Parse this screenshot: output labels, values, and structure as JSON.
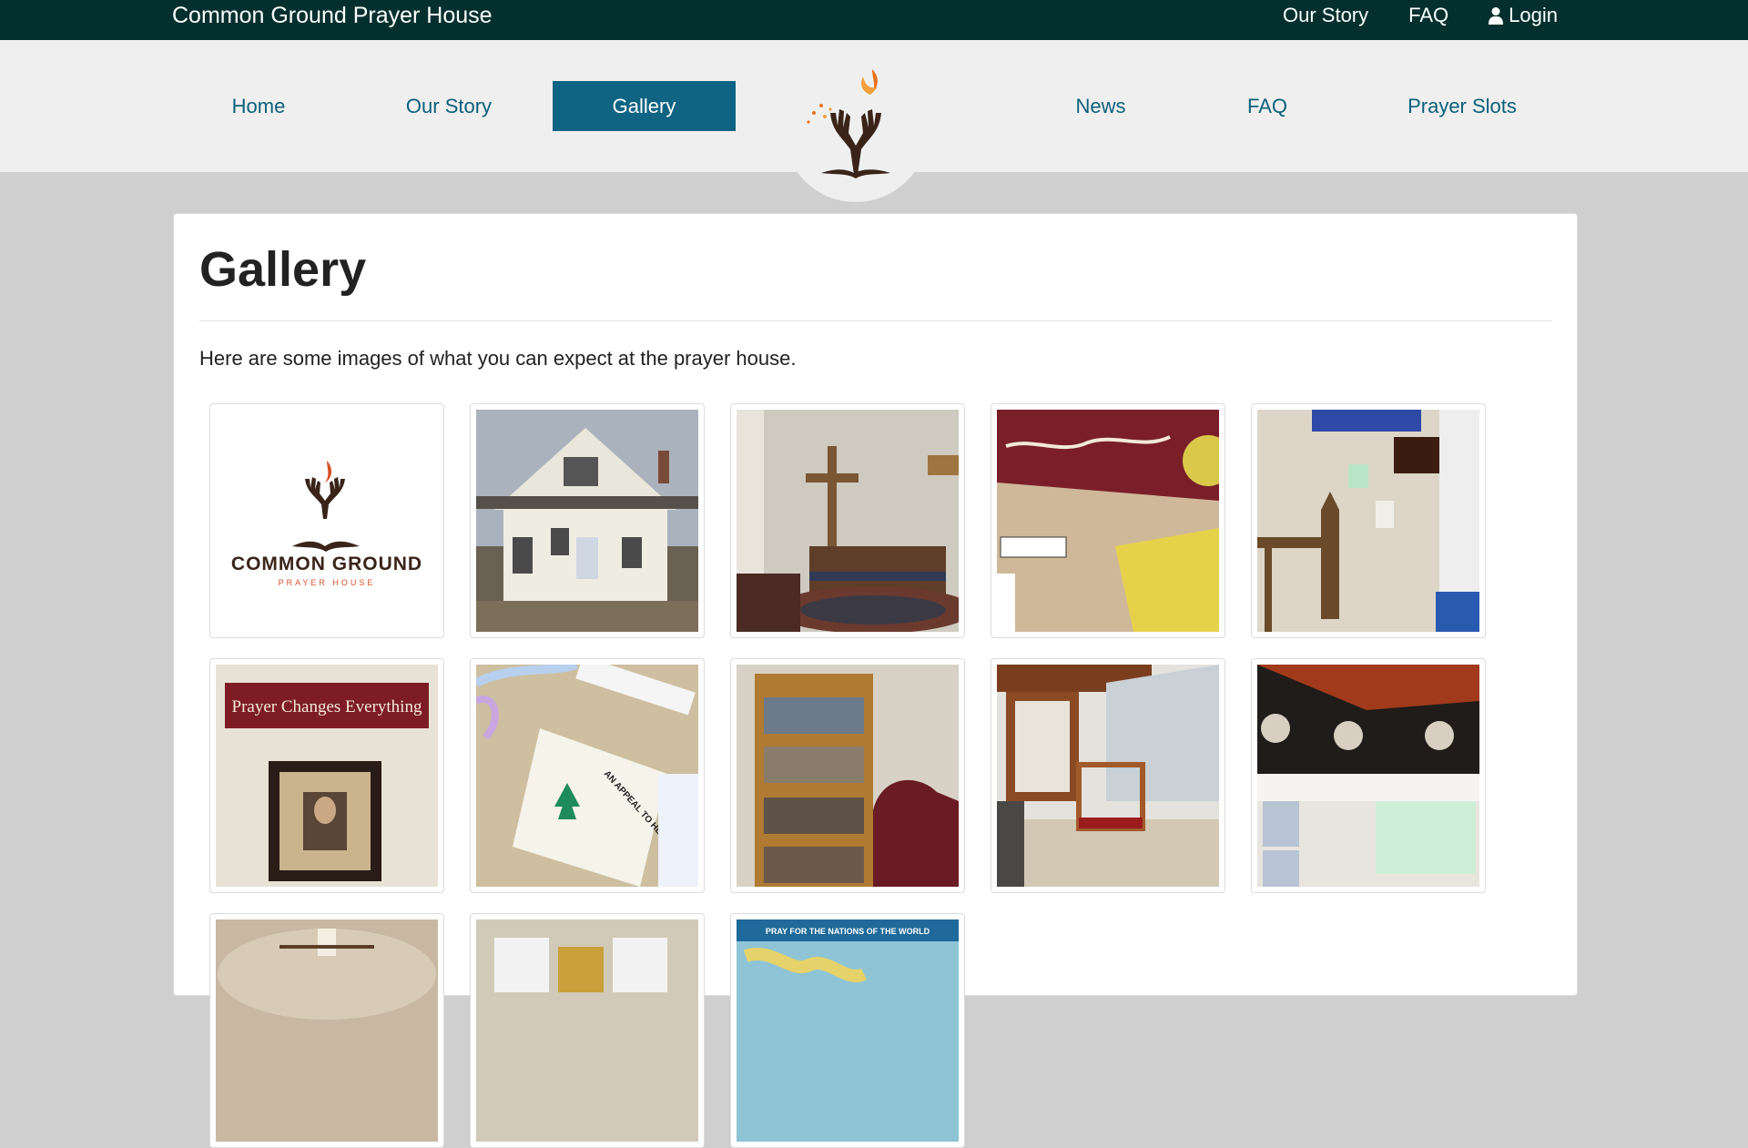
{
  "topbar": {
    "brand": "Common Ground Prayer House",
    "links": [
      "Our Story",
      "FAQ",
      "Login"
    ],
    "login_icon": "user-icon"
  },
  "nav": {
    "items": [
      "Home",
      "Our Story",
      "Gallery",
      "News",
      "FAQ",
      "Prayer Slots"
    ],
    "active": "Gallery",
    "logo_icon": "tree-hands-dove-logo"
  },
  "page": {
    "title": "Gallery",
    "intro": "Here are some images of what you can expect at the prayer house."
  },
  "gallery": {
    "items": [
      {
        "subject": "Common Ground logo",
        "text_main": "COMMON GROUND",
        "text_sub": "PRAYER HOUSE"
      },
      {
        "subject": "house exterior"
      },
      {
        "subject": "prayer room with cross"
      },
      {
        "subject": "community banner"
      },
      {
        "subject": "desk area"
      },
      {
        "subject": "prayer sign and portrait",
        "text_main": "Prayer Changes Everything"
      },
      {
        "subject": "appeal to heaven flag",
        "text_main": "AN APPEAL TO HEAVEN"
      },
      {
        "subject": "bookshelf"
      },
      {
        "subject": "kneeler by window"
      },
      {
        "subject": "government wall display"
      },
      {
        "subject": "ceiling fan room"
      },
      {
        "subject": "window room"
      },
      {
        "subject": "world map",
        "text_main": "PRAY FOR THE NATIONS OF THE WORLD"
      }
    ]
  },
  "colors": {
    "topbar": "#03302f",
    "nav_link": "#0b5f7a",
    "nav_active_bg": "#0e6482",
    "page_bg": "#cfcfcf"
  }
}
